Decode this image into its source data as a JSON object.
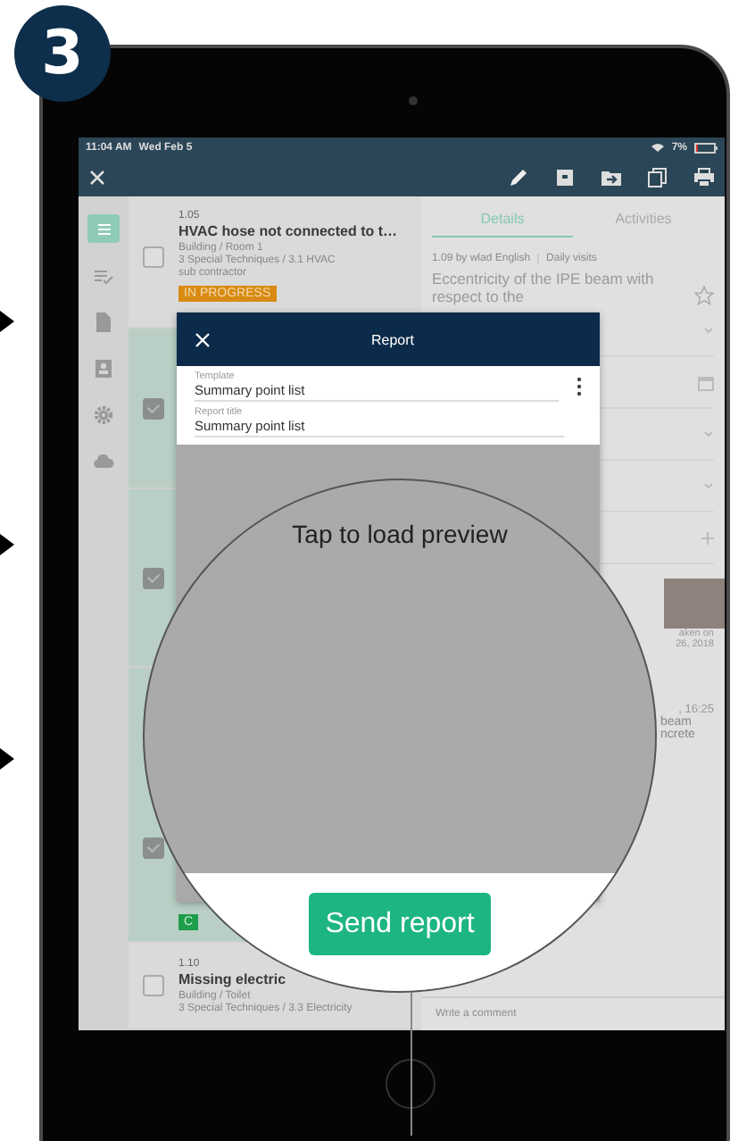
{
  "badge": {
    "number": "3"
  },
  "status_bar": {
    "time": "11:04 AM",
    "date": "Wed Feb 5",
    "battery": "7%"
  },
  "toolbar": {
    "actions": [
      {
        "kind": "edit"
      },
      {
        "kind": "archive"
      },
      {
        "kind": "move"
      },
      {
        "kind": "copy"
      },
      {
        "kind": "print"
      }
    ]
  },
  "sidebar": {
    "items": [
      {
        "kind": "list",
        "selected": true
      },
      {
        "kind": "checklist",
        "selected": false
      },
      {
        "kind": "document",
        "selected": false
      },
      {
        "kind": "contact",
        "selected": false
      },
      {
        "kind": "settings",
        "selected": false
      },
      {
        "kind": "cloud",
        "selected": false
      }
    ]
  },
  "list": {
    "items": [
      {
        "number": "1.05",
        "title": "HVAC hose not connected to t…",
        "location": "Building / Room 1",
        "category": "3 Special Techniques / 3.1 HVAC",
        "assignee": "sub contractor",
        "status": {
          "label": "IN PROGRESS",
          "color": "#d98a10"
        },
        "checked": false,
        "selected": false
      },
      {
        "checked": true,
        "selected": true
      },
      {
        "checked": true,
        "selected": true
      },
      {
        "checked": true,
        "selected": true,
        "status": {
          "label": "C",
          "color": "#1e9e4a"
        }
      },
      {
        "number": "1.10",
        "title": "Missing electric",
        "location": "Building / Toilet",
        "category": "3 Special Techniques / 3.3 Electricity",
        "checked": false,
        "selected": false
      }
    ]
  },
  "detail": {
    "tabs": [
      {
        "label": "Details",
        "selected": true
      },
      {
        "label": "Activities",
        "selected": false
      }
    ],
    "meta": "1.09 by wlad English",
    "project": "Daily visits",
    "title": "Eccentricity of the IPE beam with respect to the",
    "starred": false,
    "photo_caption": [
      "aken on",
      "26, 2018"
    ],
    "comment_time": ", 16:25",
    "comment_lines": [
      "beam",
      "ncrete"
    ],
    "comment_placeholder": "Write a comment"
  },
  "modal": {
    "title": "Report",
    "fields": [
      {
        "label": "Template",
        "value": "Summary point list",
        "menu": true
      },
      {
        "label": "Report title",
        "value": "Summary point list",
        "menu": false
      }
    ]
  },
  "magnifier": {
    "message": "Tap to load preview",
    "action": "Send report"
  }
}
